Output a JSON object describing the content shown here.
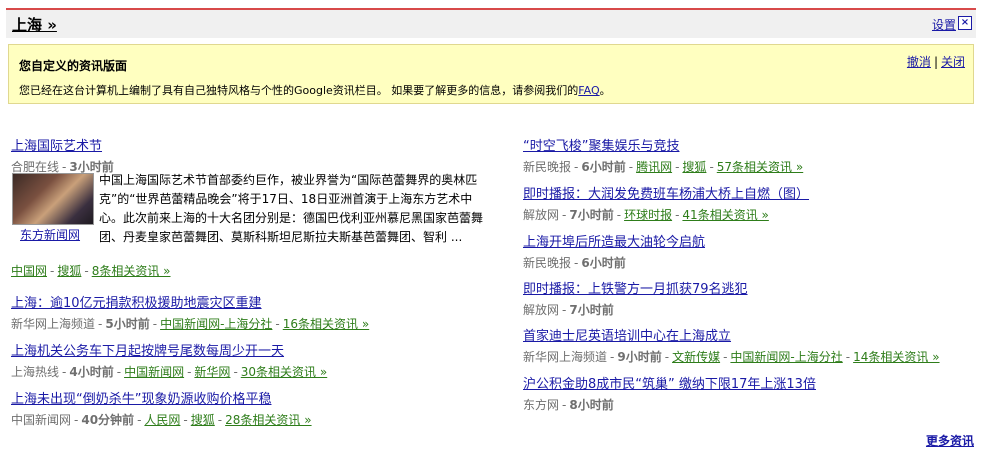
{
  "header": {
    "section_title": "上海 »",
    "settings_label": "设置",
    "close_label": "×"
  },
  "notice": {
    "title": "您自定义的资讯版面",
    "body_prefix": "您已经在这台计算机上编制了具有自己独特风格与个性的Google资讯栏目。 如果要了解更多的信息，请参阅我们的",
    "faq_link": "FAQ",
    "body_suffix": "。",
    "undo": "撤消",
    "separator": "|",
    "close": "关闭"
  },
  "featured": {
    "title": "上海国际艺术节",
    "source": "合肥在线",
    "time": "3小时前",
    "photo_caption": "东方新闻网",
    "snippet": "中国上海国际艺术节首部委约巨作，被业界誉为“国际芭蕾舞界的奥林匹克”的“世界芭蕾精品晚会”将于17日、18日亚洲首演于上海东方艺术中心。此次前来上海的十大名团分别是：德国巴伐利亚州慕尼黑国家芭蕾舞团、丹麦皇家芭蕾舞团、莫斯科斯坦尼斯拉夫斯基芭蕾舞团、智利 ...",
    "links": [
      "中国网",
      "搜狐"
    ],
    "related": "8条相关资讯 »"
  },
  "left_stories": [
    {
      "title": "上海：逾10亿元捐款积极援助地震灾区重建",
      "source": "新华网上海频道",
      "time": "5小时前",
      "links": [
        "中国新闻网-上海分社"
      ],
      "related": "16条相关资讯 »"
    },
    {
      "title": "上海机关公务车下月起按牌号尾数每周少开一天",
      "source": "上海热线",
      "time": "4小时前",
      "links": [
        "中国新闻网",
        "新华网"
      ],
      "related": "30条相关资讯 »"
    },
    {
      "title": "上海未出现“倒奶杀牛”现象奶源收购价格平稳",
      "source": "中国新闻网",
      "time": "40分钟前",
      "links": [
        "人民网",
        "搜狐"
      ],
      "related": "28条相关资讯 »"
    }
  ],
  "right_stories": [
    {
      "title": "“时空飞梭”聚集娱乐与竞技",
      "source": "新民晚报",
      "time": "6小时前",
      "links": [
        "腾讯网",
        "搜狐"
      ],
      "related": "57条相关资讯 »"
    },
    {
      "title": "即时播报：大润发免费班车杨浦大桥上自燃（图）",
      "source": "解放网",
      "time": "7小时前",
      "links": [
        "环球时报"
      ],
      "related": "41条相关资讯 »"
    },
    {
      "title": "上海开埠后所造最大油轮今启航",
      "source": "新民晚报",
      "time": "6小时前",
      "links": [],
      "related": ""
    },
    {
      "title": "即时播报：上铁警方一月抓获79名逃犯",
      "source": "解放网",
      "time": "7小时前",
      "links": [],
      "related": ""
    },
    {
      "title": "首家迪士尼英语培训中心在上海成立",
      "source": "新华网上海频道",
      "time": "9小时前",
      "links": [
        "文新传媒",
        "中国新闻网-上海分社"
      ],
      "related": "14条相关资讯 »"
    },
    {
      "title": "沪公积金助8成市民“筑巢” 缴纳下限17年上涨13倍",
      "source": "东方网",
      "time": "8小时前",
      "links": [],
      "related": ""
    }
  ],
  "footer": {
    "more_news": "更多资讯"
  }
}
